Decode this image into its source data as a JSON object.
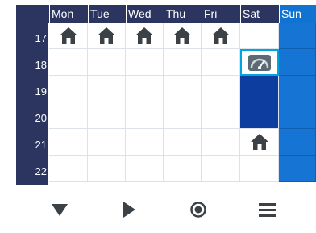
{
  "schedule": {
    "days": [
      "Mon",
      "Tue",
      "Wed",
      "Thu",
      "Fri",
      "Sat",
      "Sun"
    ],
    "hours": [
      "17",
      "18",
      "19",
      "20",
      "21",
      "22"
    ],
    "cells": [
      [
        "home-icon",
        "home-icon",
        "home-icon",
        "home-icon",
        "home-icon",
        "empty",
        "blue"
      ],
      [
        "empty",
        "empty",
        "empty",
        "empty",
        "empty",
        "eco-gauge-icon",
        "blue"
      ],
      [
        "empty",
        "empty",
        "empty",
        "empty",
        "empty",
        "dark",
        "blue"
      ],
      [
        "empty",
        "empty",
        "empty",
        "empty",
        "empty",
        "dark",
        "blue"
      ],
      [
        "empty",
        "empty",
        "empty",
        "empty",
        "empty",
        "home-icon",
        "blue"
      ],
      [
        "empty",
        "empty",
        "empty",
        "empty",
        "empty",
        "empty",
        "blue"
      ]
    ]
  },
  "colors": {
    "header_bg": "#2b3560",
    "sun_header": "#1073d1",
    "dark_block": "#0d3d9e",
    "blue_block": "#1574d4",
    "icon_color": "#3c4146"
  },
  "toolbar": {
    "buttons": [
      "triangle-down-icon",
      "play-icon",
      "record-icon",
      "menu-icon"
    ]
  }
}
